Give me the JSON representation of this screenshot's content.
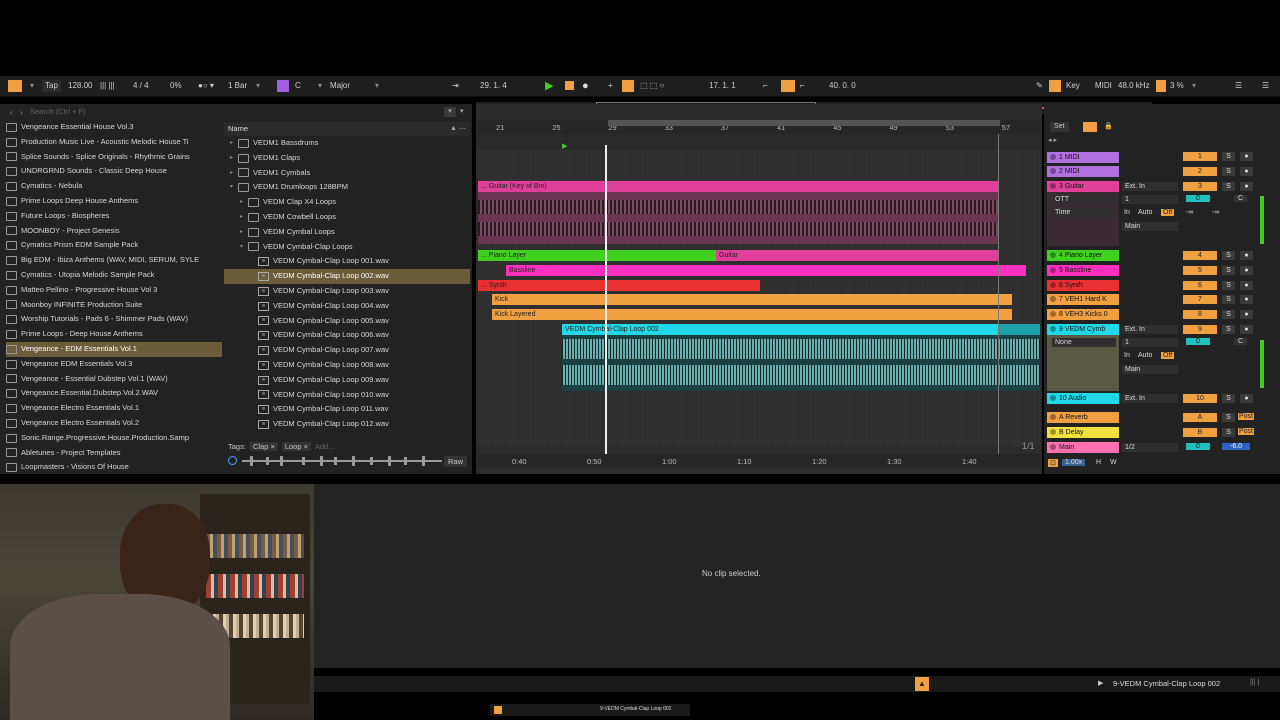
{
  "toolbar": {
    "tap": "Tap",
    "tempo": "128.00",
    "time_sig": "4 / 4",
    "swing": "0%",
    "quantize": "1 Bar",
    "key": "C",
    "scale": "Major",
    "position": "29.  1.  4",
    "loop_start": "17.  1.  1",
    "loop_length": "40.  0.  0",
    "key_label": "Key",
    "midi_label": "MIDI",
    "sample_rate": "48.0 kHz",
    "cpu": "3 %"
  },
  "browser": {
    "search_placeholder": "Search (Ctrl + F)",
    "places": [
      "Vengeance Essential House Vol.3",
      "Production Music Live - Acoustic Melodic House Ti",
      "Splice Sounds - Splice Originals - Rhythmic Grains",
      "UNDRGRND Sounds - Classic Deep House",
      "Cymatics - Nebula",
      "Prime Loops Deep House Anthems",
      "Future Loops - Biospheres",
      "MOONBOY - Project Genesis",
      "Cymatics Prism EDM Sample Pack",
      "Big EDM - Ibiza Anthems (WAV, MIDI, SERUM, SYLE",
      "Cymatics - Utopia Melodic Sample Pack",
      "Matteo Pellino - Progressive House Vol 3",
      "Moonboy INFINITE Production Suite",
      "Worship Tutorials - Pads 6 - Shimmer Pads (WAV)",
      "Prime Loops - Deep House Anthems",
      "Vengeance - EDM Essentials Vol.1",
      "Vengeance EDM Essentials Vol.3",
      "Vengeance - Essential Dubstep Vol.1 (WAV)",
      "Vengeance.Essential.Dubstep.Vol.2.WAV",
      "Vengeance Electro Essentials Vol.1",
      "Vengeance Electro Essentials Vol.2",
      "Sonic.Range.Progressive.House.Production.Samp",
      "Abletunes - Project Templates",
      "Loopmasters - Visions Of House"
    ],
    "name_header": "Name",
    "folders": [
      {
        "label": "VEDM1 Bassdrums",
        "indent": 0,
        "open": false
      },
      {
        "label": "VEDM1 Claps",
        "indent": 0,
        "open": false
      },
      {
        "label": "VEDM1 Cymbals",
        "indent": 0,
        "open": false
      },
      {
        "label": "VEDM1 Drumloops 128BPM",
        "indent": 0,
        "open": true
      },
      {
        "label": "VEDM Clap X4 Loops",
        "indent": 1,
        "open": false
      },
      {
        "label": "VEDM Cowbell Loops",
        "indent": 1,
        "open": false
      },
      {
        "label": "VEDM Cymbal Loops",
        "indent": 1,
        "open": false
      },
      {
        "label": "VEDM Cymbal-Clap Loops",
        "indent": 1,
        "open": true
      }
    ],
    "files": [
      "VEDM Cymbal-Clap Loop 001.wav",
      "VEDM Cymbal-Clap Loop 002.wav",
      "VEDM Cymbal-Clap Loop 003.wav",
      "VEDM Cymbal-Clap Loop 004.wav",
      "VEDM Cymbal-Clap Loop 005.wav",
      "VEDM Cymbal-Clap Loop 006.wav",
      "VEDM Cymbal-Clap Loop 007.wav",
      "VEDM Cymbal-Clap Loop 008.wav",
      "VEDM Cymbal-Clap Loop 009.wav",
      "VEDM Cymbal-Clap Loop 010.wav",
      "VEDM Cymbal-Clap Loop 011.wav",
      "VEDM Cymbal-Clap Loop 012.wav"
    ],
    "tags_label": "Tags:",
    "tag1": "Clap",
    "tag2": "Loop",
    "tag_add": "Add...",
    "raw": "Raw"
  },
  "arrangement": {
    "bars": [
      "21",
      "25",
      "29",
      "33",
      "37",
      "41",
      "45",
      "49",
      "53",
      "57"
    ],
    "times": [
      "0:40",
      "0:50",
      "1:00",
      "1:10",
      "1:20",
      "1:30",
      "1:40"
    ],
    "page": "1/1",
    "clips": {
      "guitar": "... Guitar (Key of Bm)",
      "piano": "... Piano Layer",
      "guitar2": "Guitar",
      "bassline": "Bassline",
      "synth": "... Synth",
      "kick": "Kick",
      "kick_layered": "Kick Layered",
      "cymbal": "VEDM Cymbal-Clap Loop 002"
    }
  },
  "tracks": {
    "set": "Set",
    "t1": "1 MIDI",
    "t2": "2 MIDI",
    "t3": "3 Guitar",
    "t4": "4 Piano Layer",
    "t5": "5 Bassline",
    "t6": "6 Synth",
    "t7": "7 VEH1 Hard K",
    "t8": "8 VEH3 Kicks 0",
    "t9": "9 VEDM Cymb",
    "t10": "10 Audio",
    "ra": "A Reverb",
    "rb": "B Delay",
    "main": "Main",
    "ext_in": "Ext. In",
    "ott": "OTT",
    "time": "Time",
    "none": "None",
    "in": "In",
    "auto": "Auto",
    "off": "Off",
    "main_out": "Main",
    "zero": "0",
    "c": "C",
    "neg_inf": "-∞",
    "post": "Post",
    "n1": "1",
    "n2": "2",
    "n3": "3",
    "n4": "4",
    "n5": "5",
    "n6": "6",
    "n7": "7",
    "n8": "8",
    "n9": "9",
    "n10": "10",
    "na": "A",
    "nb": "B",
    "s": "S",
    "half": "1/2",
    "main_vol": "-6.0",
    "zoom": "1.00x",
    "h": "H",
    "w": "W"
  },
  "detail": {
    "no_clip": "No clip selected."
  },
  "statusbar": {
    "selected": "9-VEDM Cymbal-Clap Loop 002",
    "taskbar": "9-VEDM Cymbal-Clap Loop 002"
  },
  "colors": {
    "accent": "#f0a040",
    "guitar": "#e0409a",
    "piano": "#40d020",
    "bassline": "#ff30c0",
    "synth": "#e83030",
    "kick": "#f0a040",
    "cymbal": "#20d8e8"
  }
}
